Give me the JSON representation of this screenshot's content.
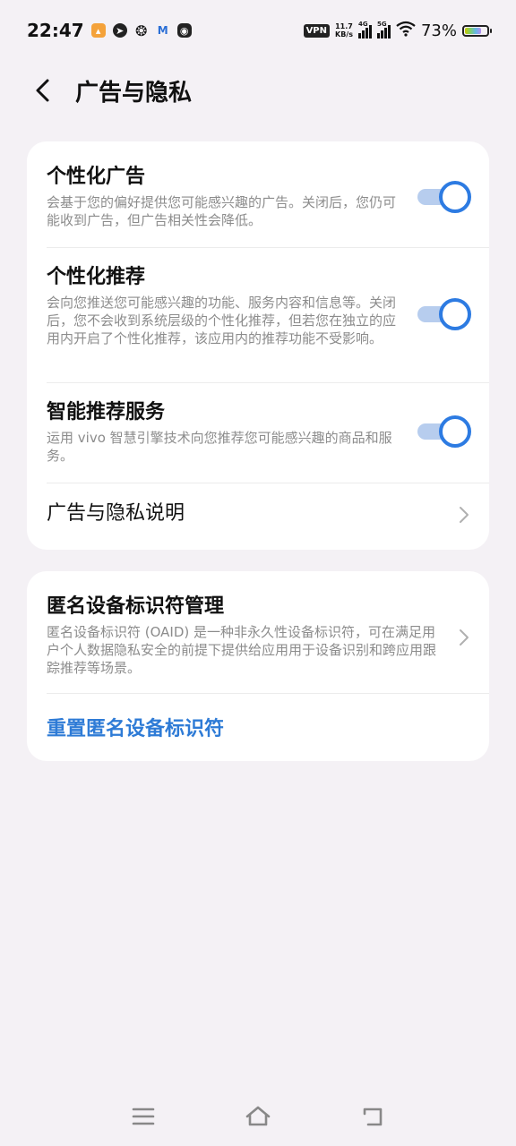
{
  "status_bar": {
    "time": "22:47",
    "vpn": "VPN",
    "speed_value": "11.7",
    "speed_unit": "KB/s",
    "net1": "4G",
    "net2": "5G",
    "battery_pct": "73%",
    "battery_level": 0.73,
    "icons": [
      "app-notification-icon",
      "telegram-icon",
      "wechat-icon",
      "gmail-icon",
      "app-icon"
    ]
  },
  "header": {
    "title": "广告与隐私"
  },
  "card1": {
    "items": [
      {
        "title": "个性化广告",
        "desc": "会基于您的偏好提供您可能感兴趣的广告。关闭后，您仍可能收到广告，但广告相关性会降低。",
        "enabled": true
      },
      {
        "title": "个性化推荐",
        "desc": "会向您推送您可能感兴趣的功能、服务内容和信息等。关闭后，您不会收到系统层级的个性化推荐，但若您在独立的应用内开启了个性化推荐，该应用内的推荐功能不受影响。",
        "enabled": true
      },
      {
        "title": "智能推荐服务",
        "desc": "运用 vivo 智慧引擎技术向您推荐您可能感兴趣的商品和服务。",
        "enabled": true
      }
    ],
    "link_item": "广告与隐私说明"
  },
  "card2": {
    "title": "匿名设备标识符管理",
    "desc": "匿名设备标识符 (OAID) 是一种非永久性设备标识符，可在满足用户个人数据隐私安全的前提下提供给应用用于设备识别和跨应用跟踪推荐等场景。",
    "reset_label": "重置匿名设备标识符"
  },
  "colors": {
    "accent": "#2d7be2",
    "background": "#f4f1f5",
    "card": "#ffffff",
    "link": "#2e7bd6"
  }
}
